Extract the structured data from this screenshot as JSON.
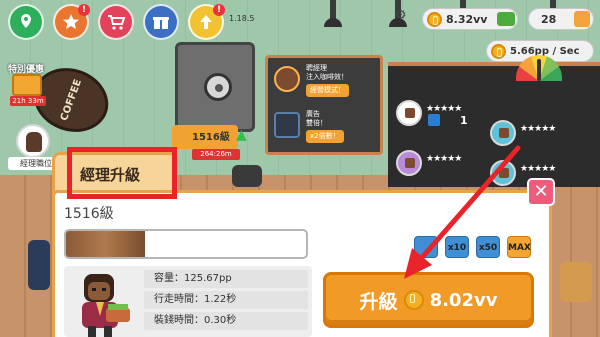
{
  "hud": {
    "version": "1.18.5",
    "currency": "8.32vv",
    "gems": "28",
    "rate": "5.66pp / Sec"
  },
  "scene": {
    "coffee_sign": "COFFEE",
    "special_offer": {
      "label": "特別優惠",
      "timer": "21h 33m"
    },
    "upgrade_tag": {
      "level": "1516級",
      "timer": "264:26m"
    },
    "manager_tag": "經理職位",
    "board": {
      "row1_text": "聘經理\n注入咖啡效！",
      "row1_btn": "經營模式！",
      "row2_text": "廣告\n雙倍！",
      "row2_btn": "x2倍數！"
    },
    "menu": [
      {
        "stars": "★★★★★",
        "num": "1"
      },
      {
        "stars": "★★★★★",
        "num": ""
      },
      {
        "stars": "★★★★★",
        "num": ""
      },
      {
        "stars": "★★★★★",
        "num": ""
      }
    ]
  },
  "panel": {
    "tab_label": "經理升級",
    "level": "1516級",
    "progress": 0.33,
    "multipliers": [
      "x1",
      "x10",
      "x50",
      "MAX"
    ],
    "stats": [
      "容量：125.67pp",
      "行走時間：1.22秒",
      "裝錢時間：0.30秒"
    ],
    "upgrade_button": {
      "label": "升級",
      "cost": "8.02vv"
    },
    "close_symbol": "✕"
  },
  "colors": {
    "accent": "#f29a26",
    "highlight": "#e8232a",
    "panel_border": "#e7a24c"
  },
  "icons": [
    "map-icon",
    "star-icon",
    "shop-cart-icon",
    "gift-icon",
    "upgrade-icon",
    "settings-gear-icon",
    "coin-icon",
    "cash-icon",
    "gem-icon"
  ]
}
